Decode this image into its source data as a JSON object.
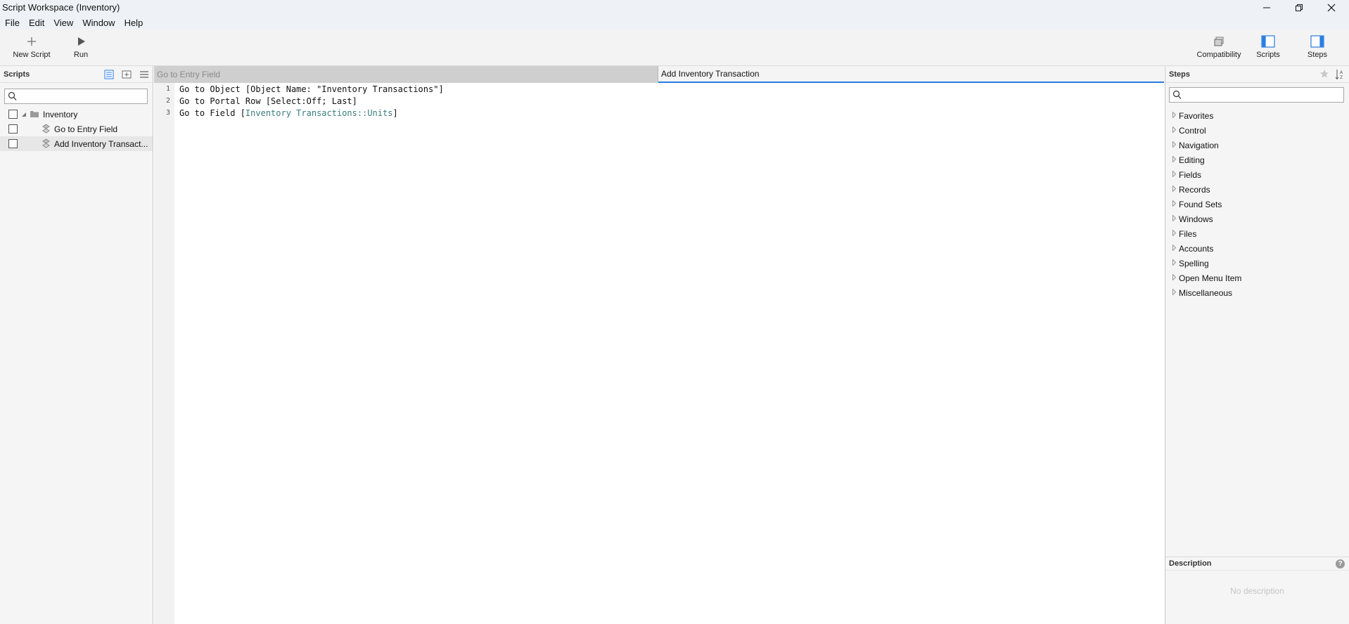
{
  "window": {
    "title": "Script Workspace (Inventory)",
    "controls": [
      "minimize-icon",
      "restore-icon",
      "close-icon"
    ]
  },
  "menubar": {
    "items": [
      "File",
      "Edit",
      "View",
      "Window",
      "Help"
    ]
  },
  "toolbar": {
    "new_script": "New Script",
    "run": "Run",
    "compatibility": "Compatibility",
    "scripts": "Scripts",
    "steps": "Steps"
  },
  "scripts_panel": {
    "title": "Scripts",
    "search_placeholder": "",
    "tree": [
      {
        "label": "Inventory",
        "type": "folder",
        "expanded": true
      },
      {
        "label": "Go to Entry Field",
        "type": "script"
      },
      {
        "label": "Add Inventory Transact...",
        "type": "script",
        "selected": true
      }
    ]
  },
  "editor": {
    "tabs": [
      {
        "label": "Go to Entry Field",
        "active": false
      },
      {
        "label": "Add Inventory Transaction",
        "active": true
      }
    ],
    "lines": [
      {
        "num": "1",
        "text": "Go to Object [Object Name: \"Inventory Transactions\"]"
      },
      {
        "num": "2",
        "text": "Go to Portal Row [Select:Off; Last]"
      },
      {
        "num": "3",
        "prefix": "Go to Field [",
        "ref": "Inventory Transactions::Units",
        "suffix": "]"
      }
    ]
  },
  "steps_panel": {
    "title": "Steps",
    "search_placeholder": "",
    "categories": [
      "Favorites",
      "Control",
      "Navigation",
      "Editing",
      "Fields",
      "Records",
      "Found Sets",
      "Windows",
      "Files",
      "Accounts",
      "Spelling",
      "Open Menu Item",
      "Miscellaneous"
    ],
    "description_title": "Description",
    "description_text": "No description"
  },
  "colors": {
    "accent": "#2a7de1",
    "field_ref": "#3a7d7d",
    "titlebar": "#eef1f6"
  }
}
